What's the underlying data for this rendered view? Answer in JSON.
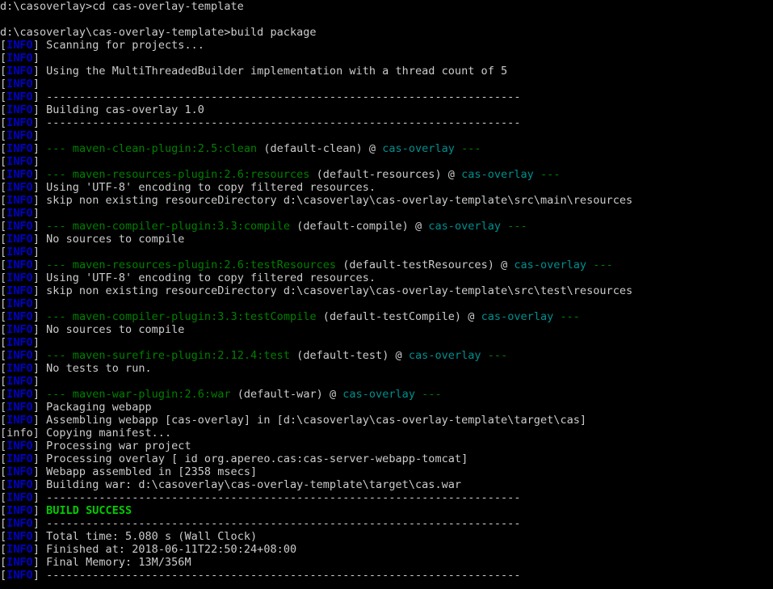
{
  "terminal": {
    "title": "Command Prompt",
    "background_color": "#000000",
    "default_text_color": "#cccccc",
    "info_tag_color": "#0000cc",
    "plugin_color": "#008000",
    "artifact_color": "#008f8f",
    "success_color": "#00cc00",
    "separator": "------------------------------------------------------------------------",
    "info_open": "[",
    "info_label": "INFO",
    "info_close": "] ",
    "lines": [
      {
        "kind": "prompt",
        "text": "d:\\casoverlay>cd cas-overlay-template"
      },
      {
        "kind": "blank",
        "text": ""
      },
      {
        "kind": "prompt",
        "text": "d:\\casoverlay\\cas-overlay-template>build package"
      },
      {
        "kind": "info",
        "text": "Scanning for projects..."
      },
      {
        "kind": "info",
        "text": ""
      },
      {
        "kind": "info",
        "text": "Using the MultiThreadedBuilder implementation with a thread count of 5"
      },
      {
        "kind": "info",
        "text": ""
      },
      {
        "kind": "info-sep",
        "text": "------------------------------------------------------------------------"
      },
      {
        "kind": "info",
        "text": "Building cas-overlay 1.0"
      },
      {
        "kind": "info-sep",
        "text": "------------------------------------------------------------------------"
      },
      {
        "kind": "info",
        "text": ""
      },
      {
        "kind": "info-goal",
        "dashes": "--- ",
        "plugin": "maven-clean-plugin:2.5:clean",
        "execution": " (default-clean) @ ",
        "artifact": "cas-overlay",
        "trail": " ---"
      },
      {
        "kind": "info",
        "text": ""
      },
      {
        "kind": "info-goal",
        "dashes": "--- ",
        "plugin": "maven-resources-plugin:2.6:resources",
        "execution": " (default-resources) @ ",
        "artifact": "cas-overlay",
        "trail": " ---"
      },
      {
        "kind": "info",
        "text": "Using 'UTF-8' encoding to copy filtered resources."
      },
      {
        "kind": "info",
        "text": "skip non existing resourceDirectory d:\\casoverlay\\cas-overlay-template\\src\\main\\resources"
      },
      {
        "kind": "info",
        "text": ""
      },
      {
        "kind": "info-goal",
        "dashes": "--- ",
        "plugin": "maven-compiler-plugin:3.3:compile",
        "execution": " (default-compile) @ ",
        "artifact": "cas-overlay",
        "trail": " ---"
      },
      {
        "kind": "info",
        "text": "No sources to compile"
      },
      {
        "kind": "info",
        "text": ""
      },
      {
        "kind": "info-goal",
        "dashes": "--- ",
        "plugin": "maven-resources-plugin:2.6:testResources",
        "execution": " (default-testResources) @ ",
        "artifact": "cas-overlay",
        "trail": " ---"
      },
      {
        "kind": "info",
        "text": "Using 'UTF-8' encoding to copy filtered resources."
      },
      {
        "kind": "info",
        "text": "skip non existing resourceDirectory d:\\casoverlay\\cas-overlay-template\\src\\test\\resources"
      },
      {
        "kind": "info",
        "text": ""
      },
      {
        "kind": "info-goal",
        "dashes": "--- ",
        "plugin": "maven-compiler-plugin:3.3:testCompile",
        "execution": " (default-testCompile) @ ",
        "artifact": "cas-overlay",
        "trail": " ---"
      },
      {
        "kind": "info",
        "text": "No sources to compile"
      },
      {
        "kind": "info",
        "text": ""
      },
      {
        "kind": "info-goal",
        "dashes": "--- ",
        "plugin": "maven-surefire-plugin:2.12.4:test",
        "execution": " (default-test) @ ",
        "artifact": "cas-overlay",
        "trail": " ---"
      },
      {
        "kind": "info",
        "text": "No tests to run."
      },
      {
        "kind": "info",
        "text": ""
      },
      {
        "kind": "info-goal",
        "dashes": "--- ",
        "plugin": "maven-war-plugin:2.6:war",
        "execution": " (default-war) @ ",
        "artifact": "cas-overlay",
        "trail": " ---"
      },
      {
        "kind": "info",
        "text": "Packaging webapp"
      },
      {
        "kind": "info",
        "text": "Assembling webapp [cas-overlay] in [d:\\casoverlay\\cas-overlay-template\\target\\cas]"
      },
      {
        "kind": "plain",
        "text": "[info] Copying manifest..."
      },
      {
        "kind": "info",
        "text": "Processing war project"
      },
      {
        "kind": "info",
        "text": "Processing overlay [ id org.apereo.cas:cas-server-webapp-tomcat]"
      },
      {
        "kind": "info",
        "text": "Webapp assembled in [2358 msecs]"
      },
      {
        "kind": "info",
        "text": "Building war: d:\\casoverlay\\cas-overlay-template\\target\\cas.war"
      },
      {
        "kind": "info-sep",
        "text": "------------------------------------------------------------------------"
      },
      {
        "kind": "info-success",
        "text": "BUILD SUCCESS"
      },
      {
        "kind": "info-sep",
        "text": "------------------------------------------------------------------------"
      },
      {
        "kind": "info",
        "text": "Total time: 5.080 s (Wall Clock)"
      },
      {
        "kind": "info",
        "text": "Finished at: 2018-06-11T22:50:24+08:00"
      },
      {
        "kind": "info",
        "text": "Final Memory: 13M/356M"
      },
      {
        "kind": "info-sep",
        "text": "------------------------------------------------------------------------"
      }
    ]
  }
}
